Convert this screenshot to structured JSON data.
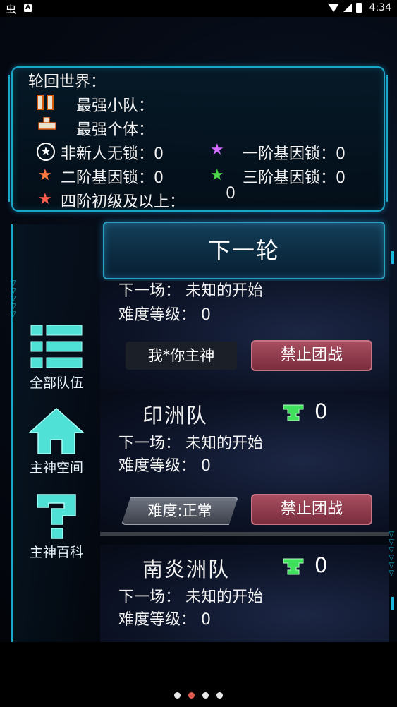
{
  "status_bar": {
    "left_glyph": "虫",
    "badge": "A",
    "time": "4:34"
  },
  "info": {
    "world_label": "轮回世界：",
    "strongest_team_label": "最强小队：",
    "strongest_individual_label": "最强个体：",
    "stats": [
      {
        "label": "非新人无锁：0",
        "icon": "circle-star-icon",
        "color": "#ffffff"
      },
      {
        "label": "一阶基因锁：0",
        "icon": "star-icon",
        "color": "#d26bff"
      },
      {
        "label": "二阶基因锁：0",
        "icon": "star-icon",
        "color": "#ff7a3c"
      },
      {
        "label": "三阶基因锁：0",
        "icon": "star-icon",
        "color": "#4cd44a"
      },
      {
        "label": "四阶初级及以上：",
        "value": "0",
        "icon": "star-icon",
        "color": "#ff5c4a"
      }
    ]
  },
  "nav": [
    {
      "label": "全部队伍",
      "icon": "list-icon"
    },
    {
      "label": "主神空间",
      "icon": "home-icon"
    },
    {
      "label": "主神百科",
      "icon": "question-icon"
    }
  ],
  "next_round_label": "下一轮",
  "cards": [
    {
      "title": "",
      "trophies": "",
      "next_match": "下一场：  未知的开始",
      "difficulty": "难度等级：  0",
      "left_button": "我*你主神",
      "ban_button": "禁止团战"
    },
    {
      "title": "印洲队",
      "trophies": "0",
      "next_match": "下一场：  未知的开始",
      "difficulty": "难度等级：  0",
      "left_button": "难度:正常",
      "ban_button": "禁止团战"
    },
    {
      "title": "南炎洲队",
      "trophies": "0",
      "next_match": "下一场：  未知的开始",
      "difficulty": "难度等级：  0"
    }
  ],
  "page_dots": {
    "count": 4,
    "active_index": 1
  }
}
